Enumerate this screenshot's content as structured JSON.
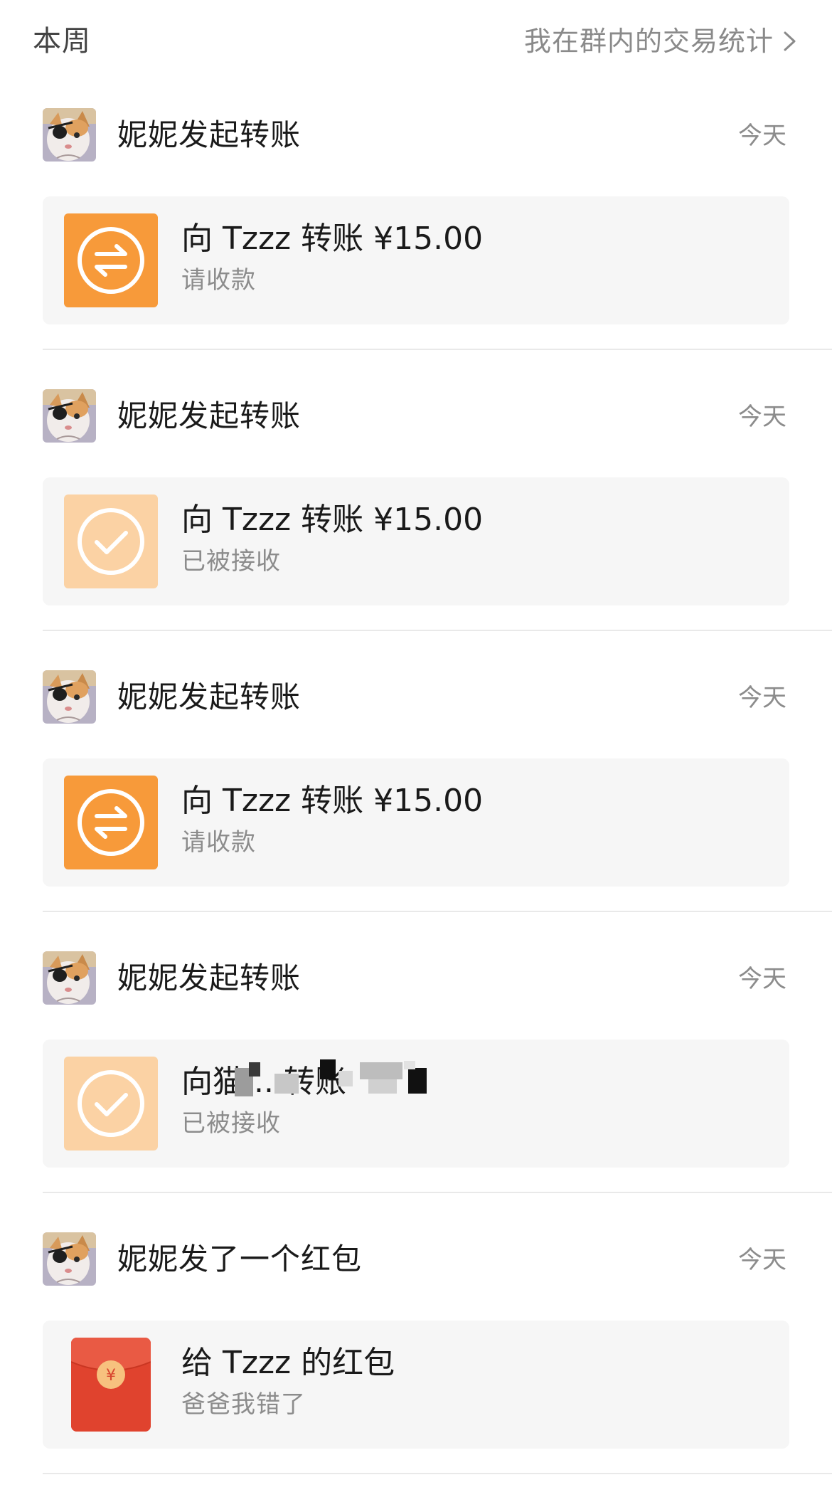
{
  "header": {
    "title": "本周",
    "stats_link_label": "我在群内的交易统计"
  },
  "records": [
    {
      "title": "妮妮发起转账",
      "time": "今天",
      "card": {
        "type": "transfer",
        "status": "pending",
        "main_text": "向 Tzzz 转账 ¥15.00",
        "sub_text": "请收款",
        "icon": "transfer-arrows-icon"
      }
    },
    {
      "title": "妮妮发起转账",
      "time": "今天",
      "card": {
        "type": "transfer",
        "status": "received",
        "main_text": "向 Tzzz 转账 ¥15.00",
        "sub_text": "已被接收",
        "icon": "checkmark-icon"
      }
    },
    {
      "title": "妮妮发起转账",
      "time": "今天",
      "card": {
        "type": "transfer",
        "status": "pending",
        "main_text": "向 Tzzz 转账 ¥15.00",
        "sub_text": "请收款",
        "icon": "transfer-arrows-icon"
      }
    },
    {
      "title": "妮妮发起转账",
      "time": "今天",
      "card": {
        "type": "transfer",
        "status": "received",
        "main_text": "向猫        ...转账",
        "sub_text": "已被接收",
        "icon": "checkmark-icon"
      }
    },
    {
      "title": "妮妮发了一个红包",
      "time": "今天",
      "card": {
        "type": "red_packet",
        "main_text": "给 Tzzz 的红包",
        "sub_text": "爸爸我错了",
        "icon": "red-packet-icon",
        "coin_symbol": "¥"
      }
    }
  ],
  "colors": {
    "transfer_pending": "#f79a3a",
    "transfer_received": "#fbd2a4",
    "red_packet": "#e0432e",
    "card_background": "#f6f6f6"
  }
}
